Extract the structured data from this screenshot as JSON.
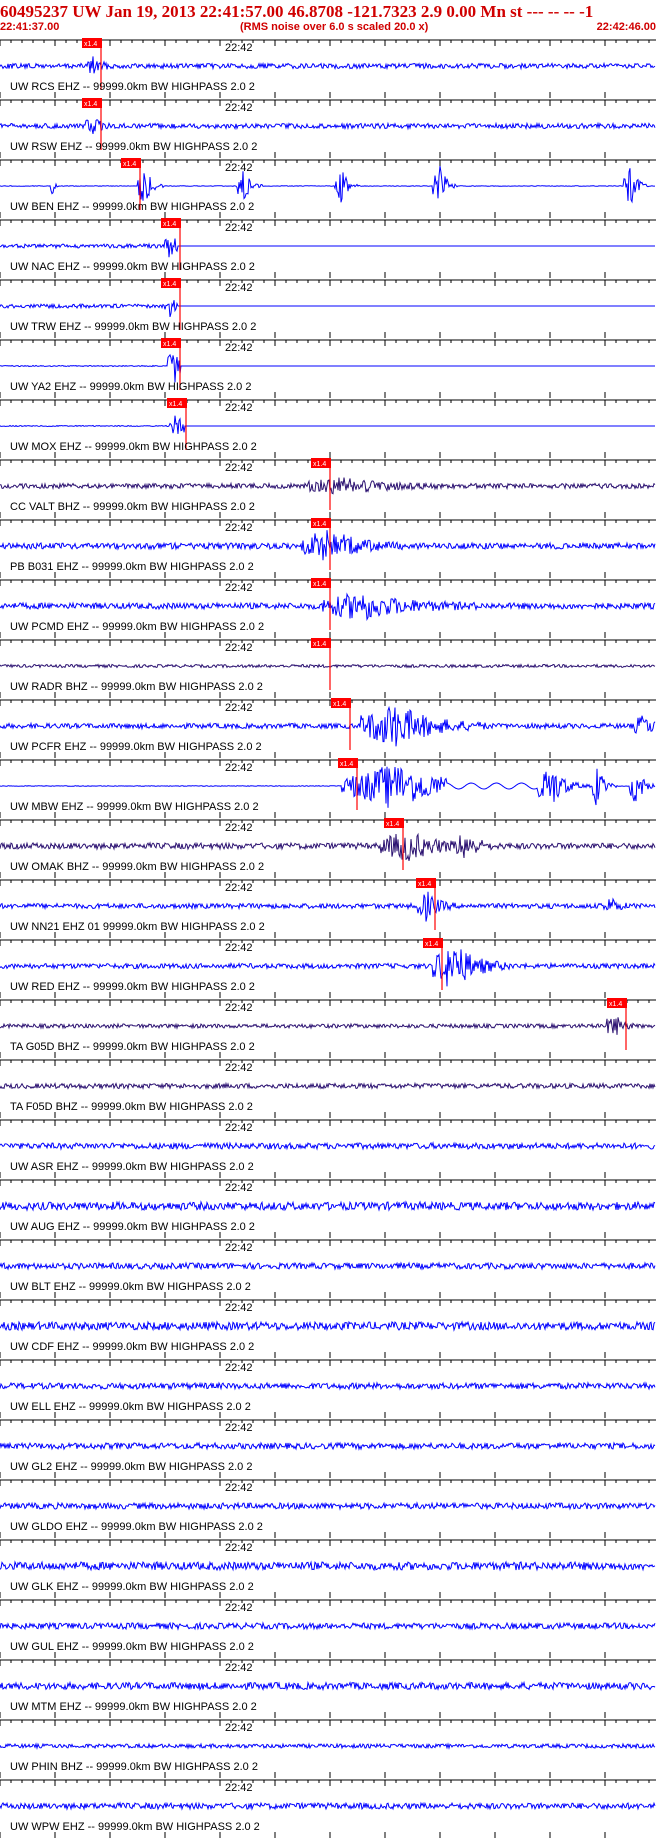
{
  "header": {
    "title": "60495237 UW Jan 19, 2013 22:41:57.00   46.8708 -121.7323  2.9 0.00 Mn st --- -- --  -1",
    "start_time": "22:41:37.00",
    "noise_note": "(RMS noise over 6.0 s scaled 20.0 x)",
    "end_time": "22:42:46.00"
  },
  "colors": {
    "header": "#d00000",
    "trace": "#0000ff",
    "trace_dark": "#2a1070",
    "pick": "#ff0000",
    "axis": "#000000"
  },
  "minute_label": "22:42",
  "pick_label": "x1.4",
  "traces": [
    {
      "label": "UW RCS EHZ -- 99999.0km BW  HIGHPASS  2.0  2",
      "pick": 0.14,
      "color": "trace",
      "style": "noise",
      "amp": 2.5,
      "events": [
        {
          "at": 0.14,
          "w": 0.01,
          "a": 10
        }
      ]
    },
    {
      "label": "UW RSW EHZ -- 99999.0km BW  HIGHPASS  2.0  2",
      "pick": 0.14,
      "color": "trace",
      "style": "noise",
      "amp": 2.5,
      "events": [
        {
          "at": 0.14,
          "w": 0.01,
          "a": 10
        }
      ]
    },
    {
      "label": "UW BEN EHZ -- 99999.0km BW  HIGHPASS  2.0  2",
      "pick": 0.2,
      "color": "trace",
      "style": "bursts",
      "amp": 0,
      "events": [
        {
          "at": 0.08,
          "w": 0.003,
          "a": 14
        },
        {
          "at": 0.22,
          "w": 0.01,
          "a": 22
        },
        {
          "at": 0.37,
          "w": 0.01,
          "a": 22
        },
        {
          "at": 0.52,
          "w": 0.01,
          "a": 22
        },
        {
          "at": 0.67,
          "w": 0.01,
          "a": 22
        },
        {
          "at": 0.96,
          "w": 0.01,
          "a": 22
        }
      ]
    },
    {
      "label": "UW NAC EHZ -- 99999.0km BW  HIGHPASS  2.0  2",
      "pick": 0.26,
      "color": "trace",
      "style": "clip",
      "amp": 2,
      "events": [
        {
          "at": 0.26,
          "w": 0.01,
          "a": 12
        }
      ]
    },
    {
      "label": "UW TRW EHZ -- 99999.0km BW  HIGHPASS  2.0  2",
      "pick": 0.26,
      "color": "trace",
      "style": "clip",
      "amp": 2,
      "events": [
        {
          "at": 0.26,
          "w": 0.01,
          "a": 12
        }
      ]
    },
    {
      "label": "UW YA2 EHZ -- 99999.0km BW  HIGHPASS  2.0  2",
      "pick": 0.26,
      "color": "trace",
      "style": "clip",
      "amp": 0.5,
      "events": [
        {
          "at": 0.265,
          "w": 0.01,
          "a": 22
        }
      ]
    },
    {
      "label": "UW MOX EHZ -- 99999.0km BW  HIGHPASS  2.0  2",
      "pick": 0.27,
      "color": "trace",
      "style": "clip",
      "amp": 0.5,
      "events": [
        {
          "at": 0.27,
          "w": 0.012,
          "a": 14
        }
      ]
    },
    {
      "label": "CC VALT BHZ -- 99999.0km BW  HIGHPASS  2.0  2",
      "pick": 0.49,
      "color": "trace_dark",
      "style": "noise",
      "amp": 2.5,
      "events": [
        {
          "at": 0.52,
          "w": 0.05,
          "a": 8
        }
      ]
    },
    {
      "label": "PB B031 EHZ -- 99999.0km BW  HIGHPASS  2.0  2",
      "pick": 0.49,
      "color": "trace",
      "style": "noise",
      "amp": 3,
      "events": [
        {
          "at": 0.5,
          "w": 0.04,
          "a": 16
        }
      ]
    },
    {
      "label": "UW PCMD EHZ -- 99999.0km BW  HIGHPASS  2.0  2",
      "pick": 0.49,
      "color": "trace",
      "style": "noise",
      "amp": 3,
      "events": [
        {
          "at": 0.55,
          "w": 0.06,
          "a": 13
        }
      ]
    },
    {
      "label": "UW RADR BHZ -- 99999.0km BW  HIGHPASS  2.0  2",
      "pick": 0.49,
      "color": "trace_dark",
      "style": "noise",
      "amp": 1.5,
      "events": []
    },
    {
      "label": "UW PCFR EHZ -- 99999.0km BW  HIGHPASS  2.0  2",
      "pick": 0.52,
      "color": "trace",
      "style": "noise",
      "amp": 2.5,
      "events": [
        {
          "at": 0.6,
          "w": 0.05,
          "a": 22
        },
        {
          "at": 0.98,
          "w": 0.015,
          "a": 10
        }
      ]
    },
    {
      "label": "UW MBW EHZ -- 99999.0km BW  HIGHPASS  2.0  2",
      "pick": 0.53,
      "color": "trace",
      "style": "mbw",
      "amp": 0,
      "events": [
        {
          "at": 0.6,
          "w": 0.08,
          "a": 24
        },
        {
          "at": 0.84,
          "w": 0.02,
          "a": 22
        },
        {
          "at": 0.91,
          "w": 0.01,
          "a": 22
        },
        {
          "at": 0.97,
          "w": 0.01,
          "a": 22
        }
      ]
    },
    {
      "label": "UW OMAK BHZ -- 99999.0km BW  HIGHPASS  2.0  2",
      "pick": 0.6,
      "color": "trace_dark",
      "style": "noise",
      "amp": 3,
      "events": [
        {
          "at": 0.62,
          "w": 0.04,
          "a": 14
        },
        {
          "at": 0.71,
          "w": 0.015,
          "a": 12
        }
      ]
    },
    {
      "label": "UW NN21 EHZ 01 99999.0km BW  HIGHPASS  2.0  2",
      "pick": 0.65,
      "color": "trace",
      "style": "noise",
      "amp": 2.5,
      "events": [
        {
          "at": 0.65,
          "w": 0.015,
          "a": 14
        },
        {
          "at": 0.93,
          "w": 0.01,
          "a": 8
        }
      ]
    },
    {
      "label": "UW RED EHZ -- 99999.0km BW  HIGHPASS  2.0  2",
      "pick": 0.66,
      "color": "trace",
      "style": "noise",
      "amp": 2.5,
      "events": [
        {
          "at": 0.69,
          "w": 0.03,
          "a": 24
        }
      ]
    },
    {
      "label": "TA G05D BHZ -- 99999.0km BW  HIGHPASS  2.0  2",
      "pick": 0.94,
      "color": "trace_dark",
      "style": "noise",
      "amp": 2,
      "events": [
        {
          "at": 0.935,
          "w": 0.01,
          "a": 14
        }
      ]
    },
    {
      "label": "TA F05D BHZ -- 99999.0km BW  HIGHPASS  2.0  2",
      "pick": null,
      "color": "trace_dark",
      "style": "noise",
      "amp": 2.5,
      "events": []
    },
    {
      "label": "UW ASR EHZ -- 99999.0km BW  HIGHPASS  2.0  2",
      "pick": null,
      "color": "trace",
      "style": "noise",
      "amp": 3,
      "events": []
    },
    {
      "label": "UW AUG EHZ -- 99999.0km BW  HIGHPASS  2.0  2",
      "pick": null,
      "color": "trace",
      "style": "noise",
      "amp": 4,
      "events": []
    },
    {
      "label": "UW BLT EHZ -- 99999.0km BW  HIGHPASS  2.0  2",
      "pick": null,
      "color": "trace",
      "style": "noise",
      "amp": 3,
      "events": []
    },
    {
      "label": "UW CDF EHZ -- 99999.0km BW  HIGHPASS  2.0  2",
      "pick": null,
      "color": "trace",
      "style": "noise",
      "amp": 4,
      "events": []
    },
    {
      "label": "UW ELL EHZ -- 99999.0km BW  HIGHPASS  2.0  2",
      "pick": null,
      "color": "trace",
      "style": "noise",
      "amp": 3,
      "events": []
    },
    {
      "label": "UW GL2 EHZ -- 99999.0km BW  HIGHPASS  2.0  2",
      "pick": null,
      "color": "trace",
      "style": "noise",
      "amp": 3,
      "events": []
    },
    {
      "label": "UW GLDO EHZ -- 99999.0km BW  HIGHPASS  2.0  2",
      "pick": null,
      "color": "trace",
      "style": "noise",
      "amp": 3,
      "events": []
    },
    {
      "label": "UW GLK EHZ -- 99999.0km BW  HIGHPASS  2.0  2",
      "pick": null,
      "color": "trace",
      "style": "noise",
      "amp": 4,
      "events": []
    },
    {
      "label": "UW GUL EHZ -- 99999.0km BW  HIGHPASS  2.0  2",
      "pick": null,
      "color": "trace",
      "style": "noise",
      "amp": 3,
      "events": []
    },
    {
      "label": "UW MTM EHZ -- 99999.0km BW  HIGHPASS  2.0  2",
      "pick": null,
      "color": "trace",
      "style": "noise",
      "amp": 3.5,
      "events": []
    },
    {
      "label": "UW PHIN BHZ -- 99999.0km BW  HIGHPASS  2.0  2",
      "pick": null,
      "color": "trace",
      "style": "noise",
      "amp": 2,
      "events": []
    },
    {
      "label": "UW WPW EHZ -- 99999.0km BW  HIGHPASS  2.0  2",
      "pick": null,
      "color": "trace",
      "style": "noise",
      "amp": 3,
      "events": []
    }
  ]
}
